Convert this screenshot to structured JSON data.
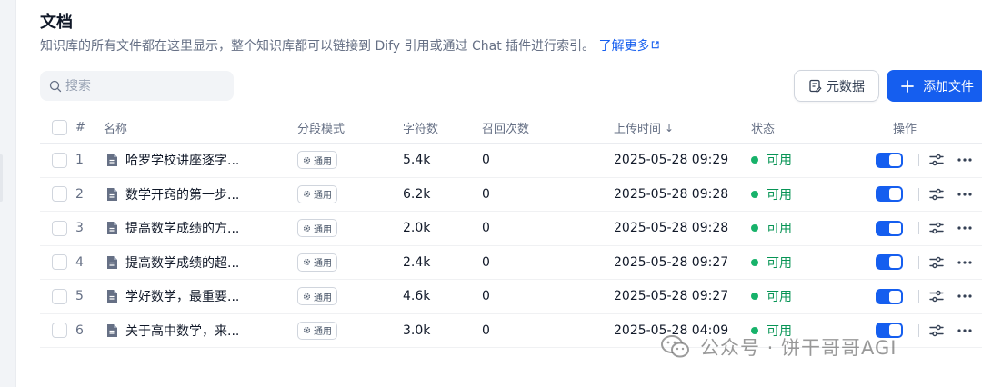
{
  "page": {
    "title": "文档",
    "description": "知识库的所有文件都在这里显示，整个知识库都可以链接到 Dify 引用或通过 Chat 插件进行索引。",
    "learn_more": "了解更多"
  },
  "search": {
    "placeholder": "搜索",
    "value": ""
  },
  "toolbar": {
    "metadata_label": "元数据",
    "add_file_label": "添加文件"
  },
  "table": {
    "headers": {
      "index": "#",
      "name": "名称",
      "mode": "分段模式",
      "chars": "字符数",
      "recall": "召回次数",
      "upload_time": "上传时间",
      "status": "状态",
      "actions": "操作"
    },
    "rows": [
      {
        "index": "1",
        "name": "哈罗学校讲座逐字...",
        "mode": "通用",
        "chars": "5.4k",
        "recall": "0",
        "time": "2025-05-28 09:29",
        "status": "可用",
        "enabled": true
      },
      {
        "index": "2",
        "name": "数学开窍的第一步...",
        "mode": "通用",
        "chars": "6.2k",
        "recall": "0",
        "time": "2025-05-28 09:28",
        "status": "可用",
        "enabled": true
      },
      {
        "index": "3",
        "name": "提高数学成绩的方...",
        "mode": "通用",
        "chars": "2.0k",
        "recall": "0",
        "time": "2025-05-28 09:28",
        "status": "可用",
        "enabled": true
      },
      {
        "index": "4",
        "name": "提高数学成绩的超...",
        "mode": "通用",
        "chars": "2.4k",
        "recall": "0",
        "time": "2025-05-28 09:27",
        "status": "可用",
        "enabled": true
      },
      {
        "index": "5",
        "name": "学好数学，最重要...",
        "mode": "通用",
        "chars": "4.6k",
        "recall": "0",
        "time": "2025-05-28 09:27",
        "status": "可用",
        "enabled": true
      },
      {
        "index": "6",
        "name": "关于高中数学，来...",
        "mode": "通用",
        "chars": "3.0k",
        "recall": "0",
        "time": "2025-05-28 04:09",
        "status": "可用",
        "enabled": true
      }
    ]
  },
  "watermark": {
    "text": "公众号 · 饼干哥哥AGI"
  },
  "colors": {
    "accent": "#155eef",
    "status_green": "#17b26a",
    "status_text": "#079455"
  },
  "icons": [
    "search-icon",
    "external-link-icon",
    "metadata-icon",
    "plus-icon",
    "document-icon",
    "gear-icon",
    "settings-icon",
    "more-icon",
    "wechat-icon"
  ]
}
